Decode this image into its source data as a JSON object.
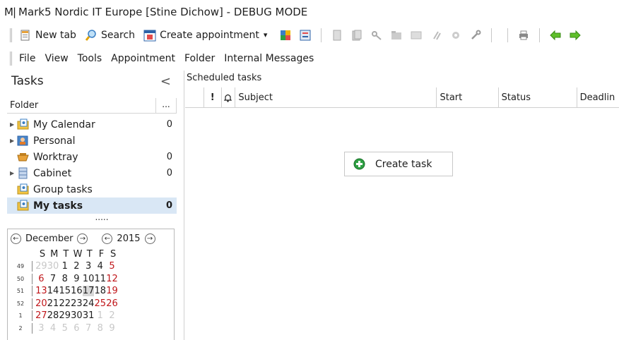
{
  "window": {
    "logo_text": "M|",
    "title": "Mark5 Nordic IT Europe [Stine Dichow] - DEBUG MODE"
  },
  "toolbar": {
    "new_tab": "New tab",
    "search": "Search",
    "create_appointment": "Create appointment",
    "dropdown_glyph": "▾"
  },
  "menu": {
    "items": [
      "File",
      "View",
      "Tools",
      "Appointment",
      "Folder",
      "Internal Messages"
    ]
  },
  "tasks_panel": {
    "title": "Tasks",
    "collapse_glyph": "<",
    "folder_label": "Folder",
    "folder_more": "...",
    "tree": [
      {
        "name": "My Calendar",
        "count": "0",
        "icon": "calendar-folder-icon",
        "expandable": true
      },
      {
        "name": "Personal",
        "count": "",
        "icon": "contacts-icon",
        "expandable": true
      },
      {
        "name": "Worktray",
        "count": "0",
        "icon": "worktray-icon",
        "expandable": false
      },
      {
        "name": "Cabinet",
        "count": "0",
        "icon": "cabinet-icon",
        "expandable": true
      },
      {
        "name": "Group tasks",
        "count": "",
        "icon": "group-tasks-icon",
        "expandable": false
      },
      {
        "name": "My tasks",
        "count": "0",
        "icon": "my-tasks-icon",
        "expandable": false,
        "selected": true
      }
    ],
    "more_dots": "....."
  },
  "calendar": {
    "month": "December",
    "year": "2015",
    "dow": [
      "S",
      "M",
      "T",
      "W",
      "T",
      "F",
      "S"
    ],
    "weeks": [
      {
        "wk": "49",
        "days": [
          "29",
          "30",
          "1",
          "2",
          "3",
          "4",
          "5"
        ]
      },
      {
        "wk": "50",
        "days": [
          "6",
          "7",
          "8",
          "9",
          "10",
          "11",
          "12"
        ]
      },
      {
        "wk": "51",
        "days": [
          "13",
          "14",
          "15",
          "16",
          "17",
          "18",
          "19"
        ]
      },
      {
        "wk": "52",
        "days": [
          "20",
          "21",
          "22",
          "23",
          "24",
          "25",
          "26"
        ]
      },
      {
        "wk": "1",
        "days": [
          "27",
          "28",
          "29",
          "30",
          "31",
          "1",
          "2"
        ]
      },
      {
        "wk": "2",
        "days": [
          "3",
          "4",
          "5",
          "6",
          "7",
          "8",
          "9"
        ]
      }
    ],
    "today": "17"
  },
  "main": {
    "section_title": "Scheduled tasks",
    "columns": {
      "priority": "!",
      "reminder": "🔔",
      "subject": "Subject",
      "start": "Start",
      "status": "Status",
      "deadline": "Deadlin"
    },
    "create_task": "Create task"
  },
  "colors": {
    "accent_green": "#2ea043",
    "weekend_red": "#c0161a",
    "selection_blue": "#d9e7f5"
  }
}
